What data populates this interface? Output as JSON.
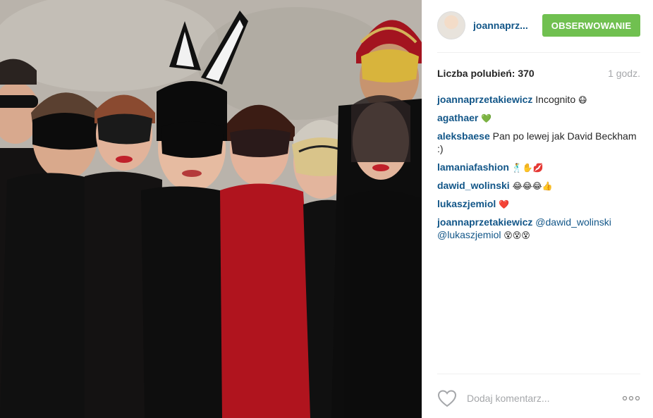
{
  "post": {
    "photo_alt": "Group of people wearing masquerade masks"
  },
  "header": {
    "username": "joannaprz...",
    "follow_label": "OBSERWOWANIE"
  },
  "stats": {
    "likes": "Liczba polubień: 370",
    "time": "1 godz."
  },
  "comments": [
    {
      "author": "joannaprzetakiewicz",
      "text": " Incognito ",
      "emoji": "😷"
    },
    {
      "author": "agathaer",
      "text": " ",
      "emoji": "💚"
    },
    {
      "author": "aleksbaese",
      "text": " Pan po lewej jak David Beckham :)",
      "emoji": ""
    },
    {
      "author": "lamaniafashion",
      "text": " ",
      "emoji": "🕺✋💋"
    },
    {
      "author": "dawid_wolinski",
      "text": " ",
      "emoji": "😂😂😂👍"
    },
    {
      "author": "lukaszjemiol",
      "text": " ",
      "emoji": "❤️"
    },
    {
      "author": "joannaprzetakiewicz",
      "mention1": " @dawid_wolinski",
      "mention2": "@lukaszjemiol",
      "emoji": " 😵😵😵"
    }
  ],
  "footer": {
    "comment_placeholder": "Dodaj komentarz..."
  },
  "colors": {
    "link": "#125688",
    "follow_bg": "#70c050",
    "muted": "#a5a7aa"
  }
}
